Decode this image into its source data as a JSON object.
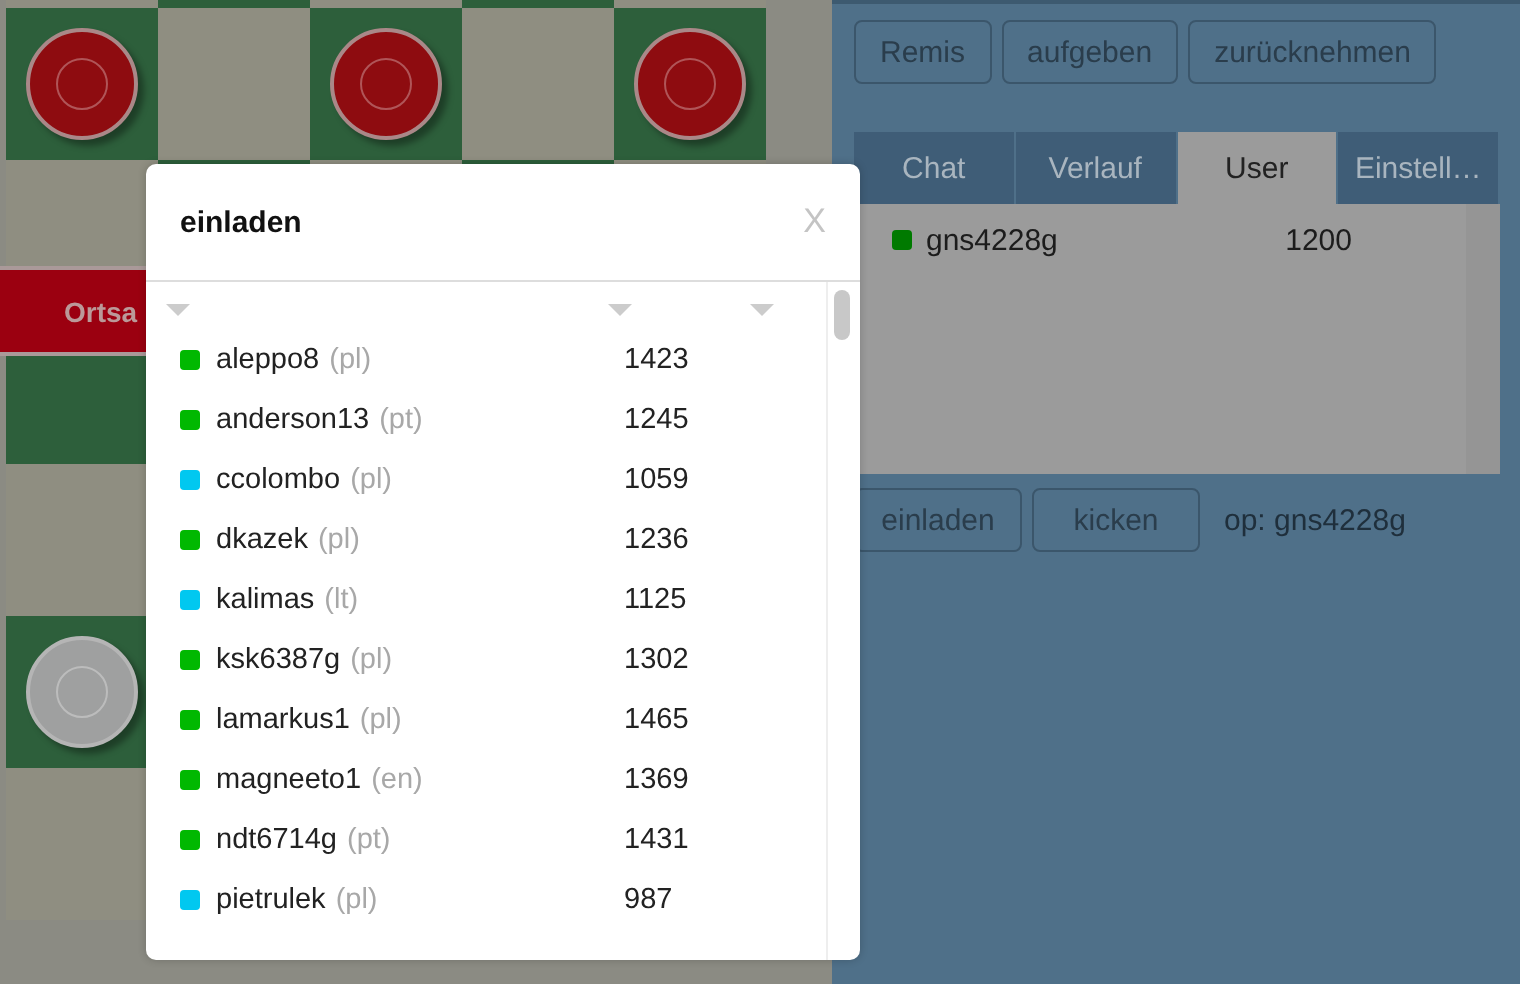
{
  "board": {
    "pieces": [
      {
        "kind": "dark"
      },
      {
        "kind": "dark"
      },
      {
        "kind": "dark"
      },
      {
        "kind": "light"
      }
    ],
    "banner": "Ortsa"
  },
  "game_buttons": [
    "Remis",
    "aufgeben",
    "zurücknehmen"
  ],
  "tabs": [
    {
      "label": "Chat",
      "selected": false
    },
    {
      "label": "Verlauf",
      "selected": false
    },
    {
      "label": "User",
      "selected": true
    },
    {
      "label": "Einstell…",
      "selected": false
    }
  ],
  "users": [
    {
      "name": "gns4228g",
      "rating": "1200",
      "color": "#007a00"
    }
  ],
  "user_buttons": [
    "einladen",
    "kicken"
  ],
  "operator": "op: gns4228g",
  "dialog": {
    "title": "einladen",
    "close": "X",
    "rows": [
      {
        "name": "aleppo8",
        "lang": "(pl)",
        "rating": "1423",
        "color": "#00b800"
      },
      {
        "name": "anderson13",
        "lang": "(pt)",
        "rating": "1245",
        "color": "#00b800"
      },
      {
        "name": "ccolombo",
        "lang": "(pl)",
        "rating": "1059",
        "color": "#00c8f0"
      },
      {
        "name": "dkazek",
        "lang": "(pl)",
        "rating": "1236",
        "color": "#00b800"
      },
      {
        "name": "kalimas",
        "lang": "(lt)",
        "rating": "1125",
        "color": "#00c8f0"
      },
      {
        "name": "ksk6387g",
        "lang": "(pl)",
        "rating": "1302",
        "color": "#00b800"
      },
      {
        "name": "lamarkus1",
        "lang": "(pl)",
        "rating": "1465",
        "color": "#00b800"
      },
      {
        "name": "magneeto1",
        "lang": "(en)",
        "rating": "1369",
        "color": "#00b800"
      },
      {
        "name": "ndt6714g",
        "lang": "(pt)",
        "rating": "1431",
        "color": "#00b800"
      },
      {
        "name": "pietrulek",
        "lang": "(pl)",
        "rating": "987",
        "color": "#00c8f0"
      }
    ]
  }
}
